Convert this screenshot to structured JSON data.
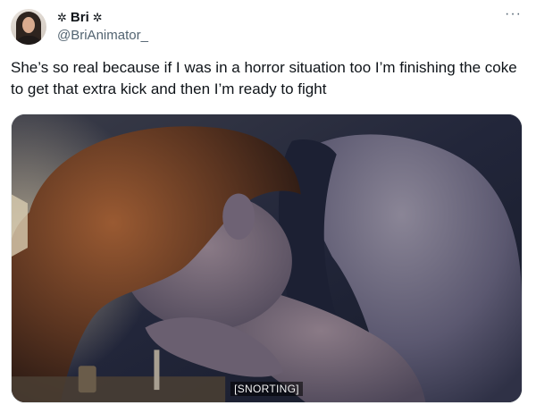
{
  "author": {
    "display_name": "Bri",
    "decoration_left": "✲",
    "decoration_right": "✲",
    "handle": "@BriAnimator_"
  },
  "menu": {
    "more_label": "···"
  },
  "tweet": {
    "text": "She’s so real because if I was in a horror situation too I’m finishing the coke to get that extra kick and then I’m ready to fight"
  },
  "media": {
    "caption": "[SNORTING]"
  },
  "icons": {
    "more": "more-horizontal-icon",
    "avatar": "profile-avatar"
  }
}
